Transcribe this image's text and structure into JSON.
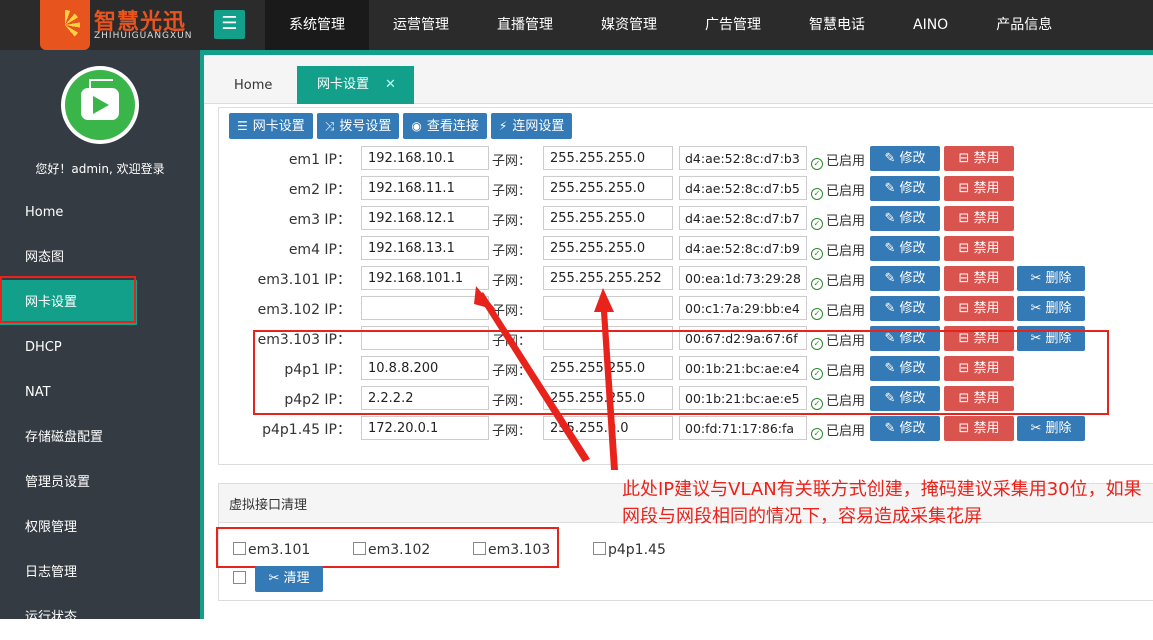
{
  "header": {
    "logo_cn": "智慧光迅",
    "logo_en": "ZHIHUIGUANGXUN",
    "menu_toggle": "☰",
    "nav": [
      "系统管理",
      "运营管理",
      "直播管理",
      "媒资管理",
      "广告管理",
      "智慧电话",
      "AINO",
      "产品信息"
    ]
  },
  "sidebar": {
    "welcome": "您好！admin, 欢迎登录",
    "items": [
      "Home",
      "网态图",
      "网卡设置",
      "DHCP",
      "NAT",
      "存储磁盘配置",
      "管理员设置",
      "权限管理",
      "日志管理",
      "运行状态"
    ]
  },
  "tabs": {
    "home": "Home",
    "active": "网卡设置",
    "close": "✕"
  },
  "toolbar": {
    "nic": "网卡设置",
    "dial": "拨号设置",
    "view": "查看连接",
    "net": "连网设置"
  },
  "row_labels": {
    "subnet": "子网：",
    "enabled": "已启用",
    "edit": "修改",
    "disable": "禁用",
    "delete": "删除"
  },
  "interfaces": [
    {
      "name": "em1 IP：",
      "ip": "192.168.10.1",
      "mask": "255.255.255.0",
      "mac": "d4:ae:52:8c:d7:b3",
      "deletable": false
    },
    {
      "name": "em2 IP：",
      "ip": "192.168.11.1",
      "mask": "255.255.255.0",
      "mac": "d4:ae:52:8c:d7:b5",
      "deletable": false
    },
    {
      "name": "em3 IP：",
      "ip": "192.168.12.1",
      "mask": "255.255.255.0",
      "mac": "d4:ae:52:8c:d7:b7",
      "deletable": false
    },
    {
      "name": "em4 IP：",
      "ip": "192.168.13.1",
      "mask": "255.255.255.0",
      "mac": "d4:ae:52:8c:d7:b9",
      "deletable": false
    },
    {
      "name": "em3.101 IP：",
      "ip": "192.168.101.1",
      "mask": "255.255.255.252",
      "mac": "00:ea:1d:73:29:28",
      "deletable": true
    },
    {
      "name": "em3.102 IP：",
      "ip": "",
      "mask": "",
      "mac": "00:c1:7a:29:bb:e4",
      "deletable": true
    },
    {
      "name": "em3.103 IP：",
      "ip": "",
      "mask": "",
      "mac": "00:67:d2:9a:67:6f",
      "deletable": true
    },
    {
      "name": "p4p1 IP：",
      "ip": "10.8.8.200",
      "mask": "255.255.255.0",
      "mac": "00:1b:21:bc:ae:e4",
      "deletable": false
    },
    {
      "name": "p4p2 IP：",
      "ip": "2.2.2.2",
      "mask": "255.255.255.0",
      "mac": "00:1b:21:bc:ae:e5",
      "deletable": false
    },
    {
      "name": "p4p1.45 IP：",
      "ip": "172.20.0.1",
      "mask": "255.255.0.0",
      "mac": "00:fd:71:17:86:fa",
      "deletable": true
    }
  ],
  "virtual": {
    "title": "虚拟接口清理",
    "items": [
      "em3.101",
      "em3.102",
      "em3.103",
      "p4p1.45"
    ],
    "clear": "清理"
  },
  "annotation": "此处IP建议与VLAN有关联方式创建，掩码建议采集用30位，如果网段与网段相同的情况下，容易造成采集花屏",
  "colors": {
    "accent": "#12a08a",
    "primary": "#337ab7",
    "danger": "#d9534f",
    "highlight": "#e8231c",
    "sidebar": "#343b42"
  }
}
